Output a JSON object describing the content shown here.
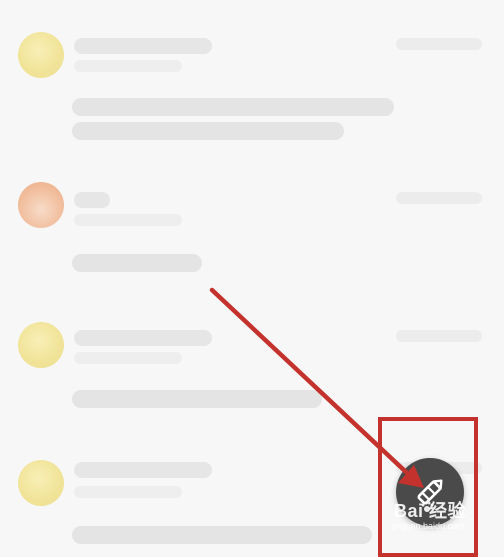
{
  "feed": {
    "posts": [
      {
        "name": "",
        "sub": "",
        "meta": "",
        "lines": [
          "",
          ""
        ]
      },
      {
        "name": "",
        "sub": "",
        "meta": "",
        "lines": [
          ""
        ]
      },
      {
        "name": "",
        "sub": "",
        "meta": "",
        "lines": [
          ""
        ]
      },
      {
        "name": "",
        "sub": "",
        "meta": "",
        "lines": [
          ""
        ]
      }
    ]
  },
  "fab": {
    "icon": "pencil-edit-icon"
  },
  "annotation": {
    "arrow_color": "#c3322c",
    "box_color": "#c3322c"
  },
  "watermark": {
    "brand": "Bai 经验",
    "url": "jingyan.baidu.com",
    "icon": "paw-icon"
  },
  "colors": {
    "background": "#f7f7f7",
    "fab": "#4a4a4a",
    "avatar_yellow": "#f1e49a",
    "avatar_orange": "#f2c2a3"
  }
}
